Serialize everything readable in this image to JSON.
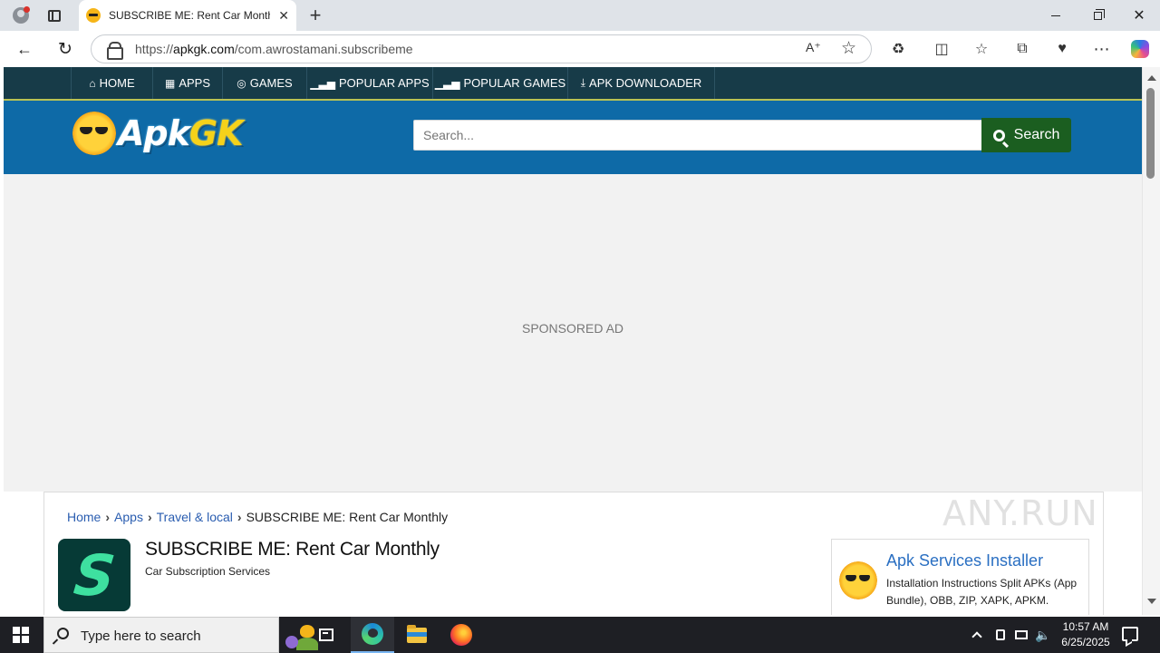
{
  "browser": {
    "tab_title": "SUBSCRIBE ME: Rent Car Monthly",
    "url_prefix": "https://",
    "url_domain": "apkgk.com",
    "url_path": "/com.awrostamani.subscribeme",
    "read_aloud_label": "Á⁾",
    "tab_close": "✕",
    "new_tab": "+",
    "window_close": "✕"
  },
  "nav": {
    "items": [
      {
        "icon": "⌂",
        "label": "HOME"
      },
      {
        "icon": "▦",
        "label": "APPS"
      },
      {
        "icon": "◎",
        "label": "GAMES"
      },
      {
        "icon": "▁▃▅",
        "label": "POPULAR APPS"
      },
      {
        "icon": "▁▃▅",
        "label": "POPULAR GAMES"
      },
      {
        "icon": "⤓",
        "label": "APK DOWNLOADER"
      }
    ]
  },
  "header": {
    "logo_apk": "Apk",
    "logo_gk": "GK",
    "search_placeholder": "Search...",
    "search_button": "Search"
  },
  "ad": {
    "label": "SPONSORED AD"
  },
  "breadcrumb": {
    "items": [
      "Home",
      "Apps",
      "Travel & local"
    ],
    "current": "SUBSCRIBE ME: Rent Car Monthly"
  },
  "app": {
    "icon_letter": "S",
    "title": "SUBSCRIBE ME: Rent Car Monthly",
    "subtitle": "Car Subscription Services"
  },
  "sidebar_card": {
    "title": "Apk Services Installer",
    "description": "Installation Instructions Split APKs (App Bundle), OBB, ZIP, XAPK, APKM."
  },
  "watermark": "ANY.RUN",
  "taskbar": {
    "search_placeholder": "Type here to search",
    "volume_icon": "🔈",
    "time": "10:57 AM",
    "date": "6/25/2025"
  },
  "colors": {
    "nav_bg": "#173b48",
    "header_bg": "#0e6aa7",
    "search_button_bg": "#1b5e20",
    "link": "#2a5db0"
  }
}
